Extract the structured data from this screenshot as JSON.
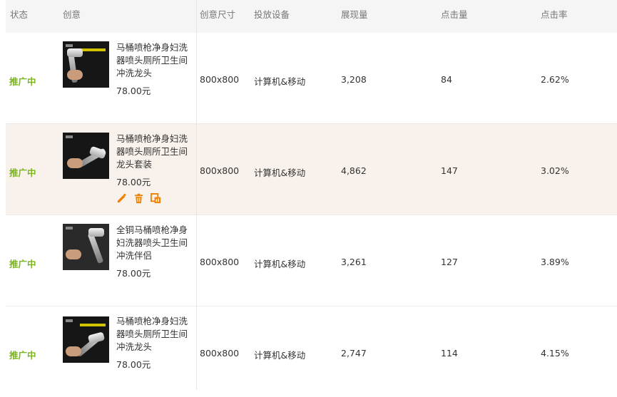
{
  "headers": {
    "status": "状态",
    "creative": "创意",
    "size": "创意尺寸",
    "device": "投放设备",
    "impressions": "展现量",
    "clicks": "点击量",
    "ctr": "点击率"
  },
  "rows": [
    {
      "status": "推广中",
      "title": "马桶喷枪净身妇洗器喷头厕所卫生间冲洗龙头",
      "price": "78.00元",
      "size": "800x800",
      "device": "计算机&移动",
      "impressions": "3,208",
      "clicks": "84",
      "ctr": "2.62%"
    },
    {
      "status": "推广中",
      "title": "马桶喷枪净身妇洗器喷头厕所卫生间龙头套装",
      "price": "78.00元",
      "size": "800x800",
      "device": "计算机&移动",
      "impressions": "4,862",
      "clicks": "147",
      "ctr": "3.02%"
    },
    {
      "status": "推广中",
      "title": "全铜马桶喷枪净身妇洗器喷头卫生间冲洗伴侣",
      "price": "78.00元",
      "size": "800x800",
      "device": "计算机&移动",
      "impressions": "3,261",
      "clicks": "127",
      "ctr": "3.89%"
    },
    {
      "status": "推广中",
      "title": "马桶喷枪净身妇洗器喷头厕所卫生间冲洗龙头",
      "price": "78.00元",
      "size": "800x800",
      "device": "计算机&移动",
      "impressions": "2,747",
      "clicks": "114",
      "ctr": "4.15%"
    }
  ],
  "row_actions": {
    "icons": [
      "edit-icon",
      "delete-icon",
      "report-icon"
    ],
    "color": "#f08000"
  },
  "colors": {
    "status_active": "#7ab61b",
    "row_highlight": "#f9f2ec",
    "header_bg": "#f5f5f5"
  }
}
